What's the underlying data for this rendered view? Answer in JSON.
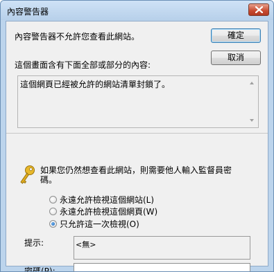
{
  "window": {
    "title": "內容警告器",
    "close_label": "✕"
  },
  "message": {
    "line1": "內容警告器不允許您查看此網站。",
    "line2": "這個畫面含有下面全部或部分的內容:",
    "rating_content": "這個網頁已經被允許的網站清單封鎖了。"
  },
  "buttons": {
    "ok_label": "確定",
    "cancel_label": "取消"
  },
  "supervisor": {
    "prompt_line1": "如果您仍然想查看此網站，則需要他人輸入監督員密",
    "prompt_line2": "碼。",
    "options": [
      {
        "label": "永遠允許檢視這個網站(L)",
        "selected": false
      },
      {
        "label": "永遠允許檢視這個網頁(W)",
        "selected": false
      },
      {
        "label": "只允許這一次檢視(O)",
        "selected": true
      }
    ],
    "hint_label": "提示:",
    "hint_value": "<無>",
    "password_label": "密碼(P):",
    "password_value": ""
  }
}
